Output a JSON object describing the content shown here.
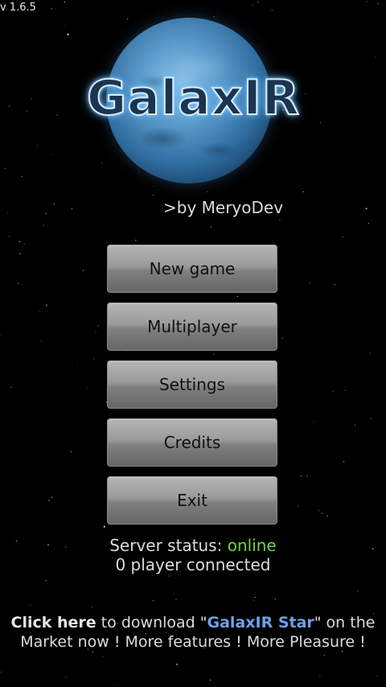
{
  "app": {
    "version": "v 1.6.5",
    "logo_text": "GalaxIR",
    "byline": ">by MeryoDev"
  },
  "menu": {
    "items": [
      {
        "label": "New game"
      },
      {
        "label": "Multiplayer"
      },
      {
        "label": "Settings"
      },
      {
        "label": "Credits"
      },
      {
        "label": "Exit"
      }
    ]
  },
  "status": {
    "server_label": "Server status:",
    "server_value": "online",
    "server_value_color": "#6bd63a",
    "players_text": "0 player connected"
  },
  "promo": {
    "click_here": "Click here",
    "text_before_name": " to download \"",
    "app_name": "GalaxIR Star",
    "app_name_color": "#6fa0e8",
    "text_after_name": "\" on the",
    "line2": "Market now ! More features ! More Pleasure !"
  }
}
